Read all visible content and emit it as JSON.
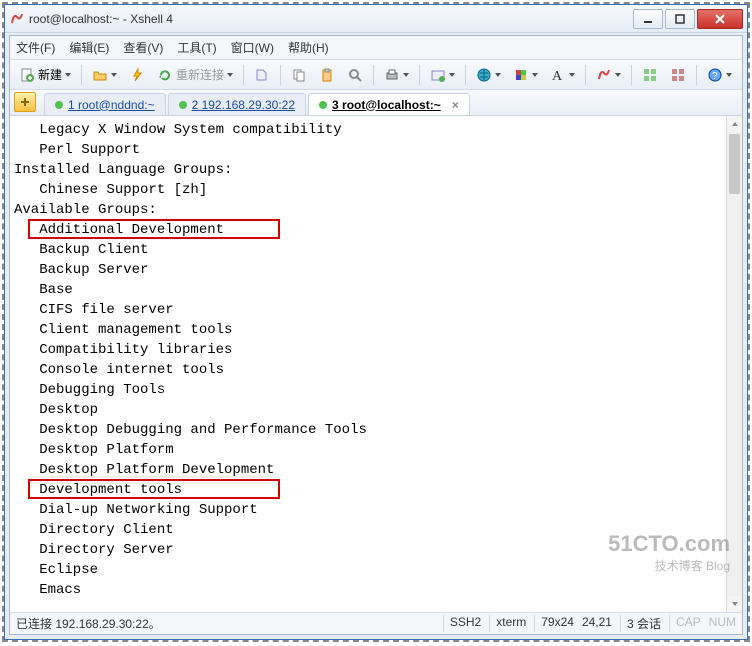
{
  "window": {
    "title": "root@localhost:~ - Xshell 4"
  },
  "menu": {
    "file": "文件(F)",
    "edit": "编辑(E)",
    "view": "查看(V)",
    "tools": "工具(T)",
    "window": "窗口(W)",
    "help": "帮助(H)"
  },
  "toolbar": {
    "new_label": "新建",
    "reconnect_label": "重新连接"
  },
  "tabs": [
    {
      "label": "1 root@nddnd:~",
      "active": false
    },
    {
      "label": "2 192.168.29.30:22",
      "active": false
    },
    {
      "label": "3 root@localhost:~",
      "active": true
    }
  ],
  "terminal": {
    "lines": [
      "   Legacy X Window System compatibility",
      "   Perl Support",
      "Installed Language Groups:",
      "   Chinese Support [zh]",
      "Available Groups:",
      "   Additional Development",
      "   Backup Client",
      "   Backup Server",
      "   Base",
      "   CIFS file server",
      "   Client management tools",
      "   Compatibility libraries",
      "   Console internet tools",
      "   Debugging Tools",
      "   Desktop",
      "   Desktop Debugging and Performance Tools",
      "   Desktop Platform",
      "   Desktop Platform Development",
      "   Development tools",
      "   Dial-up Networking Support",
      "   Directory Client",
      "   Directory Server",
      "   Eclipse",
      "   Emacs"
    ]
  },
  "status": {
    "left": "已连接 192.168.29.30:22。",
    "ssh": "SSH2",
    "term": "xterm",
    "size": "79x24",
    "pos": "24,21",
    "sess": "3 会话",
    "caps": "CAP",
    "num": "NUM"
  },
  "watermark": {
    "big": "51CTO.com",
    "small": "技术博客  Blog"
  }
}
